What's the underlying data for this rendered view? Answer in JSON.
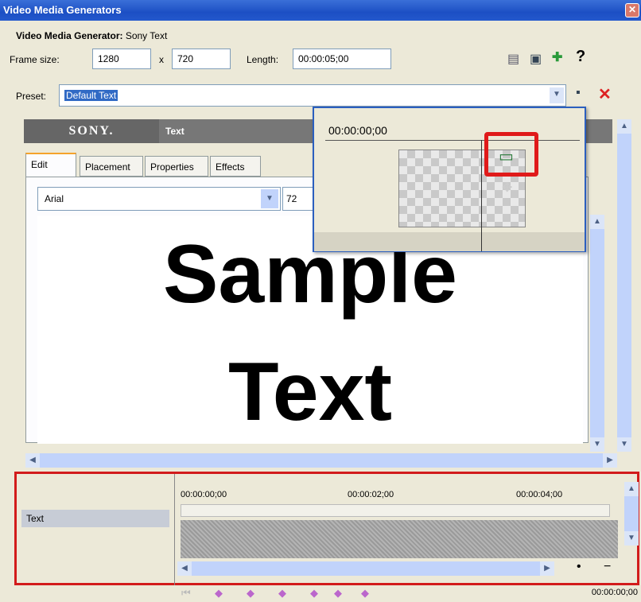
{
  "window": {
    "title": "Video Media Generators"
  },
  "generator": {
    "label": "Video Media Generator:",
    "name": "Sony Text"
  },
  "frame": {
    "size_label": "Frame size:",
    "width": "1280",
    "x": "x",
    "height": "720",
    "length_label": "Length:",
    "length": "00:00:05;00"
  },
  "preset": {
    "label": "Preset:",
    "value": "Default Text"
  },
  "sony": {
    "logo": "SONY.",
    "plugin": "Text"
  },
  "tabs": [
    "Edit",
    "Placement",
    "Properties",
    "Effects"
  ],
  "font": {
    "family": "Arial",
    "size": "72"
  },
  "sample": {
    "line1": "Sample",
    "line2": "Text"
  },
  "popup": {
    "time": "00:00:00;00"
  },
  "timeline": {
    "track_label": "Text",
    "ticks": [
      "00:00:00;00",
      "00:00:02;00",
      "00:00:04;00"
    ],
    "end_time": "00:00:00;00"
  },
  "colors": {
    "accent": "#2b5fbf",
    "highlight": "#e01a1a",
    "face": "#ece9d8"
  }
}
